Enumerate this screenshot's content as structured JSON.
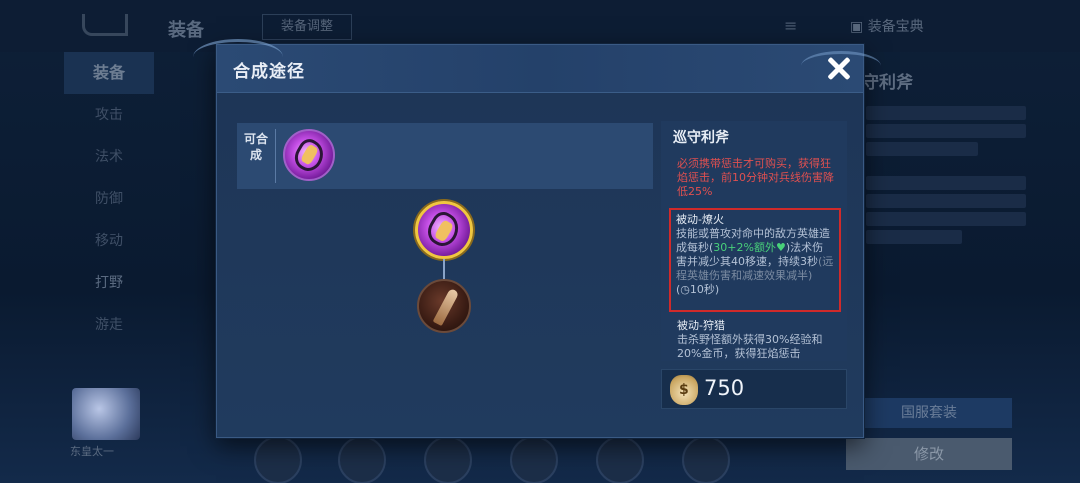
{
  "background": {
    "title": "装备",
    "tab_label": "装备调整",
    "dict_label": "装备宝典",
    "sidebar_items": [
      "装备",
      "攻击",
      "法术",
      "防御",
      "移动",
      "打野",
      "游走"
    ],
    "hero_name": "东皇太一",
    "right_title": "守利斧",
    "btn_server": "国服套装",
    "btn_modify": "修改"
  },
  "modal": {
    "title": "合成途径",
    "composable_label": "可合成",
    "item": {
      "name": "巡守利斧",
      "warning": "必须携带惩击才可购买，获得狂焰惩击，前10分钟对兵线伤害降低25%",
      "passive1_title": "被动-燎火",
      "passive1_text_a": "技能或普攻对命中的敌方英雄造成每秒(",
      "passive1_green": "30+2%额外♥",
      "passive1_text_b": ")法术伤害并减少其40移速，持续3秒",
      "passive1_gray": "(远程英雄伤害和减速效果减半)",
      "passive1_cd": "(◷10秒)",
      "passive2_title": "被动-狩猎",
      "passive2_text": "击杀野怪额外获得30%经验和20%金币，获得狂焰惩击",
      "price": "750"
    },
    "icons": {
      "composable": "purple-axe-item-icon",
      "result": "purple-axe-item-icon",
      "component": "hunting-blade-item-icon",
      "coin": "coin-bag-icon",
      "close": "close-icon"
    }
  }
}
